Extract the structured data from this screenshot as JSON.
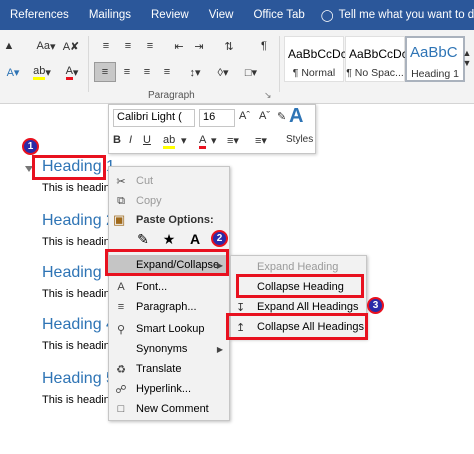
{
  "tabs": [
    "References",
    "Mailings",
    "Review",
    "View",
    "Office Tab"
  ],
  "tell_me": "Tell me what you want to do...",
  "ribbon": {
    "aa_label": "Aa",
    "paragraph_label": "Paragraph",
    "styles": [
      {
        "sample": "AaBbCcDc",
        "name": "¶ Normal"
      },
      {
        "sample": "AaBbCcDc",
        "name": "¶ No Spac..."
      },
      {
        "sample": "AaBbC",
        "name": "Heading 1"
      }
    ]
  },
  "mini_toolbar": {
    "font": "Calibri Light (",
    "size": "16",
    "styles_label": "Styles"
  },
  "document": {
    "headings": [
      "Heading 1",
      "Heading 2",
      "Heading 3",
      "Heading 4",
      "Heading 5"
    ],
    "body": [
      "This is heading",
      "This is headin",
      "This is headin",
      "This is headin",
      "This is headin"
    ]
  },
  "context_menu": {
    "cut": "Cut",
    "copy": "Copy",
    "paste_options": "Paste Options:",
    "expand_collapse": "Expand/Collapse",
    "font": "Font...",
    "paragraph": "Paragraph...",
    "smart_lookup": "Smart Lookup",
    "synonyms": "Synonyms",
    "translate": "Translate",
    "hyperlink": "Hyperlink...",
    "new_comment": "New Comment"
  },
  "submenu": {
    "expand_heading": "Expand Heading",
    "collapse_heading": "Collapse Heading",
    "expand_all": "Expand All Headings",
    "collapse_all": "Collapse All Headings"
  },
  "badges": [
    "1",
    "2",
    "3"
  ],
  "colors": {
    "ribbon_blue": "#2b579a",
    "heading_blue": "#2e74b5",
    "highlight_red": "#e8111f",
    "badge_blue": "#2a2aa8"
  }
}
